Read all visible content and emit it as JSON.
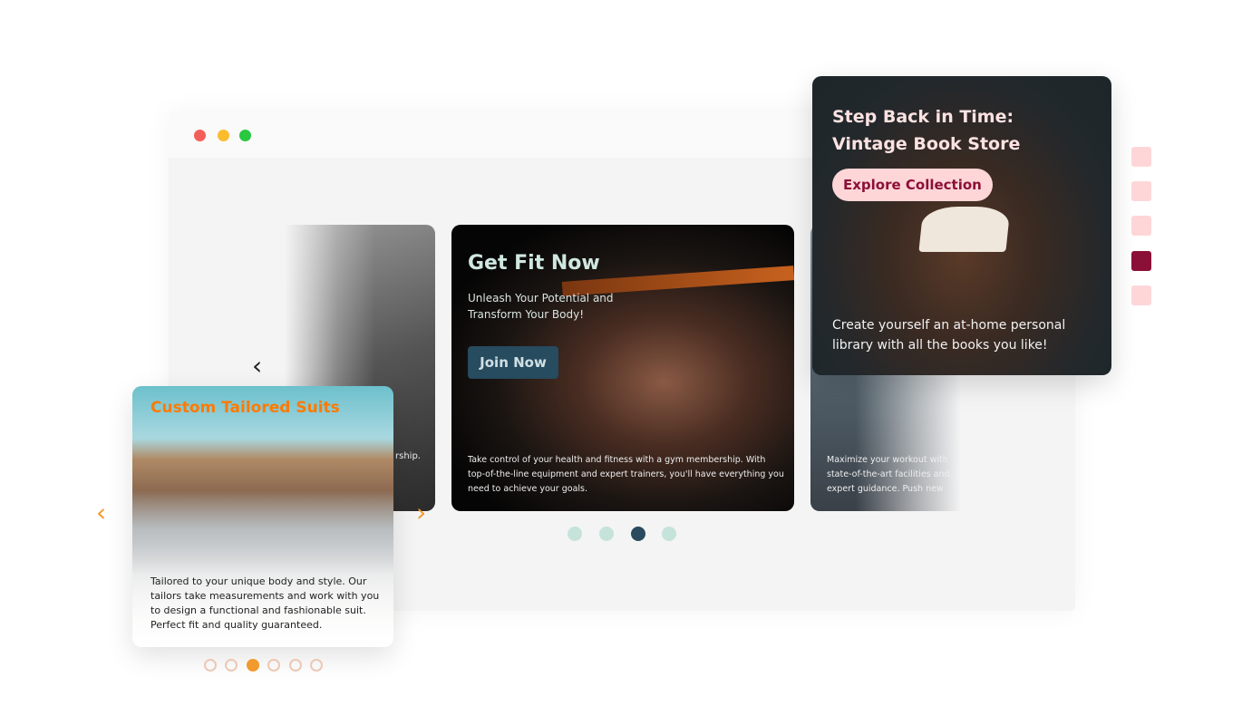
{
  "gym_carousel": {
    "title": "Get Fit Now",
    "subtitle": "Unleash Your Potential and Transform Your Body!",
    "button": "Join Now",
    "description": "Take control of your health and fitness with a gym membership. With top-of-the-line equipment and expert trainers, you'll have everything you need to achieve your goals.",
    "next_slide_text": "Maximize your workout with state-of-the-art facilities and expert guidance. Push new limits and achieve your",
    "prev_slide_text_fragment": "rship.",
    "prev_icon": "chevron-left-icon",
    "dots": 4,
    "active_dot": 3,
    "colors": {
      "active_dot": "#2a4a5e",
      "dot": "#c5e3da",
      "button": "#274b5f"
    }
  },
  "suit_carousel": {
    "title": "Custom Tailored Suits",
    "description": "Tailored to your unique body and style. Our tailors take measurements and work with you to design a functional and fashionable suit. Perfect fit and quality guaranteed.",
    "prev_icon": "chevron-left-icon",
    "next_icon": "chevron-right-icon",
    "dots": 6,
    "active_dot": 3,
    "colors": {
      "accent": "#ff7a00",
      "active_dot": "#f29a2e"
    }
  },
  "book_carousel": {
    "title_line1": "Step Back in Time:",
    "title_line2": "Vintage Book Store",
    "button": "Explore Collection",
    "description": "Create yourself an at-home personal library with all the books you like!",
    "indicators": 5,
    "active_indicator": 4,
    "colors": {
      "indicator": "#ffd6d8",
      "active_indicator": "#8b1038"
    }
  }
}
